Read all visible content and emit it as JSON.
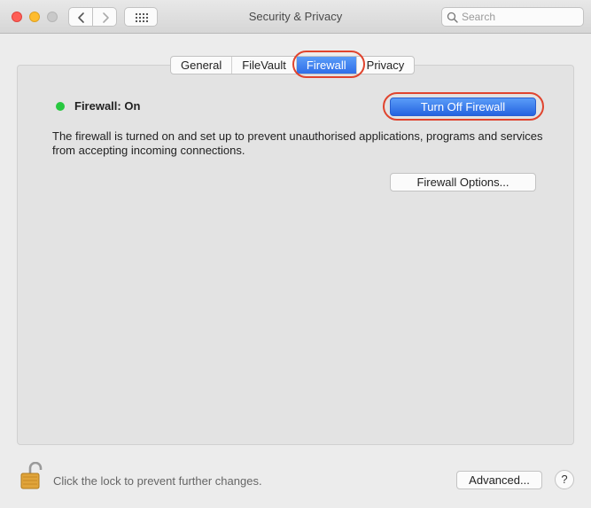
{
  "window": {
    "title": "Security & Privacy"
  },
  "toolbar": {
    "search_placeholder": "Search"
  },
  "tabs": [
    {
      "label": "General",
      "active": false
    },
    {
      "label": "FileVault",
      "active": false
    },
    {
      "label": "Firewall",
      "active": true
    },
    {
      "label": "Privacy",
      "active": false
    }
  ],
  "firewall": {
    "status_label": "Firewall: On",
    "status_color": "#28c840",
    "toggle_button": "Turn Off Firewall",
    "description": "The firewall is turned on and set up to prevent unauthorised applications, programs and services from accepting incoming connections.",
    "options_button": "Firewall Options..."
  },
  "footer": {
    "lock_text": "Click the lock to prevent further changes.",
    "advanced_button": "Advanced...",
    "help_label": "?"
  },
  "colors": {
    "accent": "#2f6ee8",
    "highlight_ring": "#e0442e"
  }
}
